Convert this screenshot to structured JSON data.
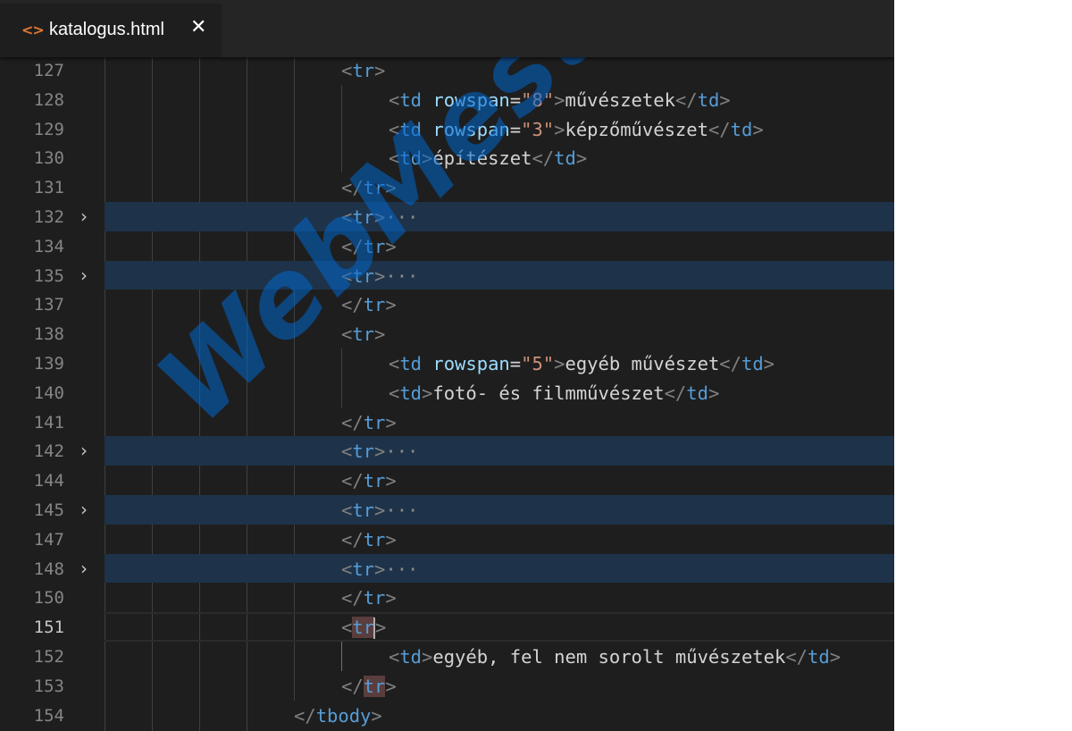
{
  "tab": {
    "icon": "code-file-icon",
    "filename": "katalogus.html",
    "close": "✕"
  },
  "fold_icon": "›",
  "watermark": "WebMesterKE",
  "lines": [
    {
      "num": "127"
    },
    {
      "num": "128"
    },
    {
      "num": "129"
    },
    {
      "num": "130"
    },
    {
      "num": "131"
    },
    {
      "num": "132"
    },
    {
      "num": "134"
    },
    {
      "num": "135"
    },
    {
      "num": "137"
    },
    {
      "num": "138"
    },
    {
      "num": "139"
    },
    {
      "num": "140"
    },
    {
      "num": "141"
    },
    {
      "num": "142"
    },
    {
      "num": "144"
    },
    {
      "num": "145"
    },
    {
      "num": "147"
    },
    {
      "num": "148"
    },
    {
      "num": "150"
    },
    {
      "num": "151"
    },
    {
      "num": "152"
    },
    {
      "num": "153"
    },
    {
      "num": "154"
    }
  ],
  "code": {
    "lt": "<",
    "gt": ">",
    "lts": "</",
    "eq": "=",
    "ellipsis": "···",
    "tr": "tr",
    "td": "td",
    "tbody": "tbody",
    "rowspan": "rowspan",
    "v8": "\"8\"",
    "v3": "\"3\"",
    "v5": "\"5\"",
    "t128": "művészetek",
    "t129": "képzőművészet",
    "t130": "építészet",
    "t139": "egyéb művészet",
    "t140": "fotó- és filmművészet",
    "t152": "egyéb, fel nem sorolt művészetek"
  }
}
